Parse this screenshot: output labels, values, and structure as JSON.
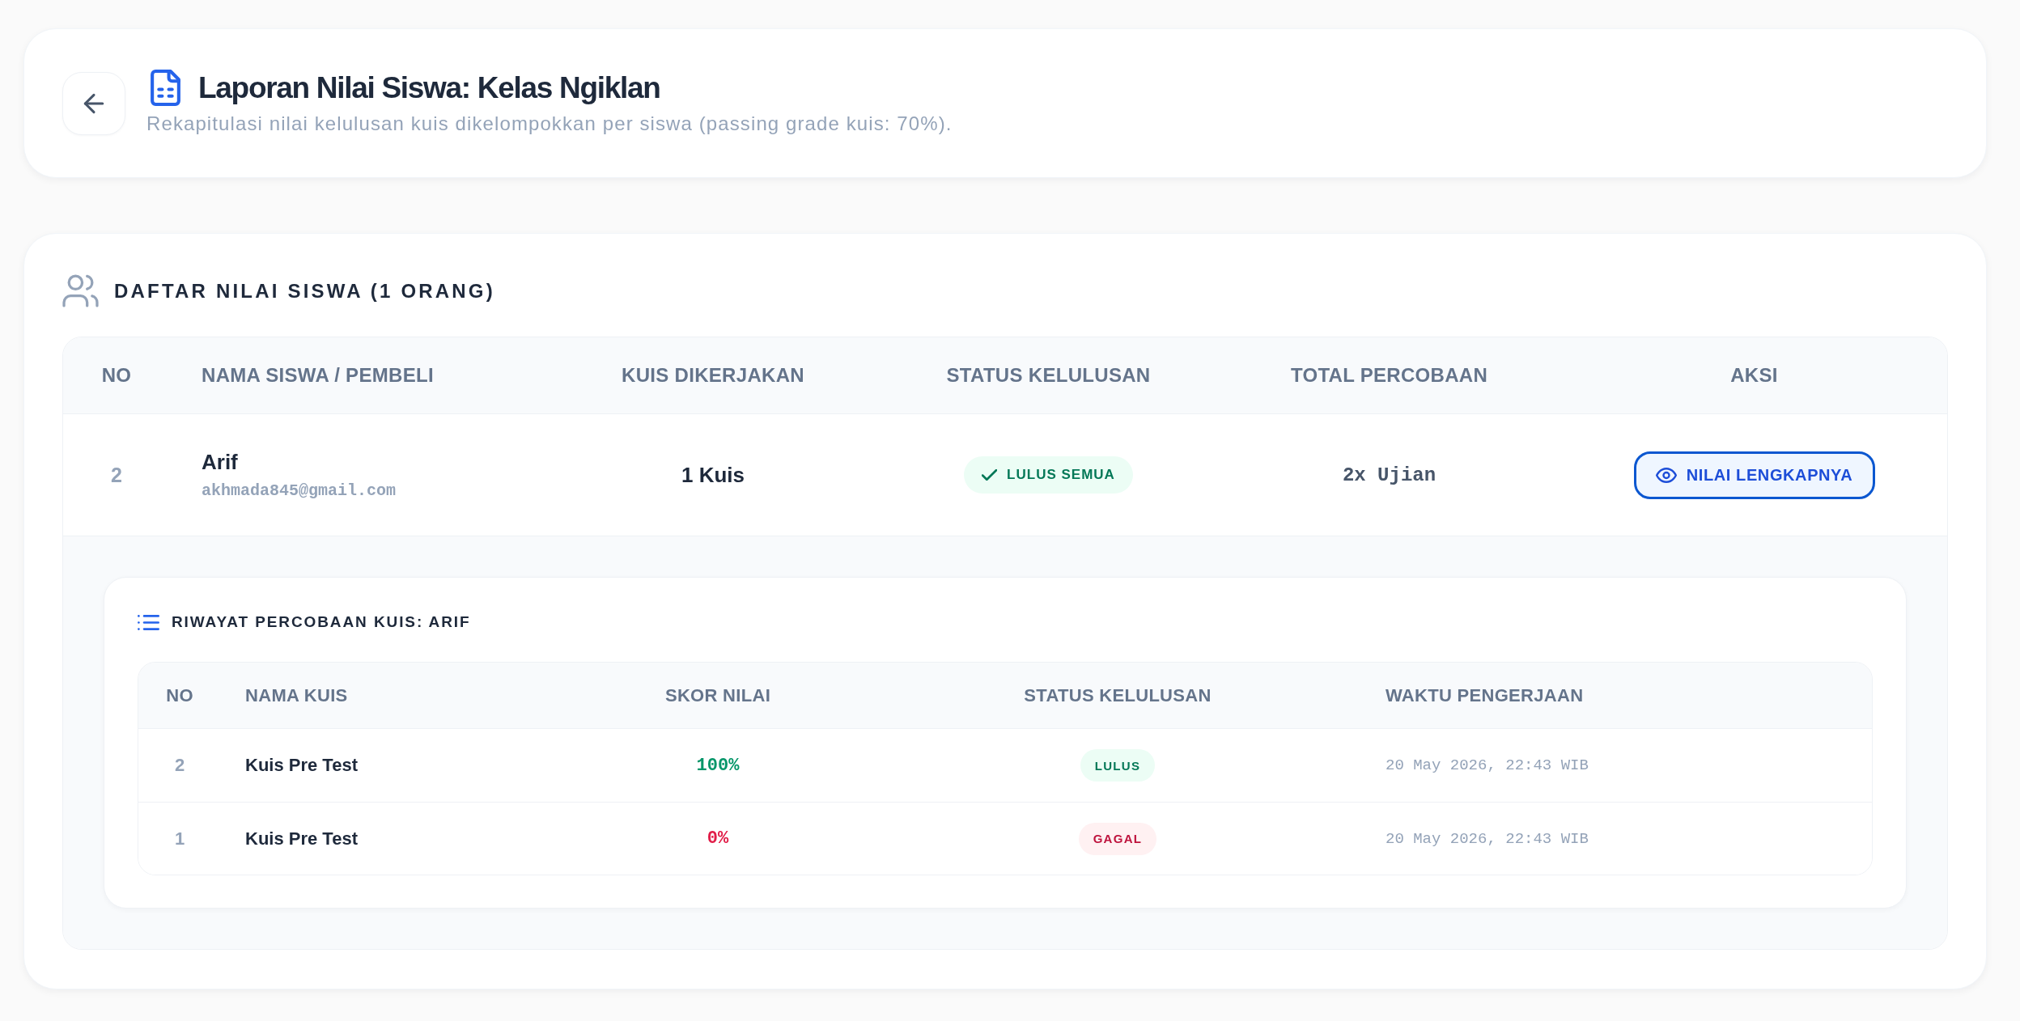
{
  "header": {
    "title": "Laporan Nilai Siswa: Kelas Ngiklan",
    "subtitle": "Rekapitulasi nilai kelulusan kuis dikelompokkan per siswa (passing grade kuis: 70%)."
  },
  "students": {
    "title": "DAFTAR NILAI SISWA (1 ORANG)",
    "columns": [
      "NO",
      "NAMA SISWA / PEMBELI",
      "KUIS DIKERJAKAN",
      "STATUS KELULUSAN",
      "TOTAL PERCOBAAN",
      "AKSI"
    ],
    "rows": [
      {
        "no": "2",
        "name": "Arif",
        "email": "akhmada845@gmail.com",
        "quizzes": "1 Kuis",
        "status": {
          "kind": "pass",
          "label": "LULUS SEMUA"
        },
        "attempts": "2x Ujian",
        "action": "NILAI LENGKAPNYA",
        "expanded": true,
        "history": {
          "title": "RIWAYAT PERCOBAAN KUIS: ARIF",
          "columns": [
            "NO",
            "NAMA KUIS",
            "SKOR NILAI",
            "STATUS KELULUSAN",
            "WAKTU PENGERJAAN"
          ],
          "rows": [
            {
              "no": "2",
              "quiz": "Kuis Pre Test",
              "score": "100%",
              "kind": "pass",
              "status": "LULUS",
              "time": "20 May 2026, 22:43 WIB"
            },
            {
              "no": "1",
              "quiz": "Kuis Pre Test",
              "score": "0%",
              "kind": "fail",
              "status": "GAGAL",
              "time": "20 May 2026, 22:43 WIB"
            }
          ]
        }
      }
    ]
  }
}
